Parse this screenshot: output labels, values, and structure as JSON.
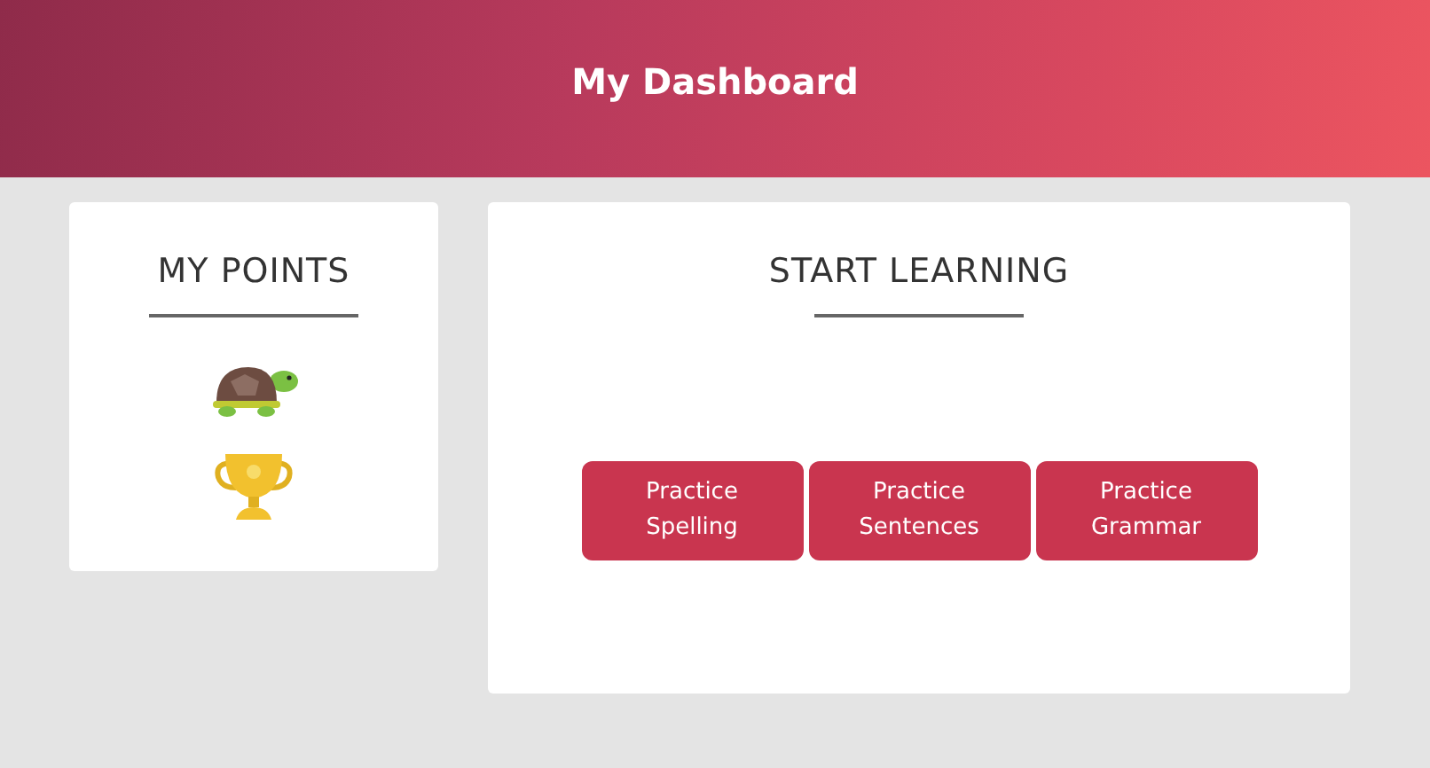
{
  "header": {
    "title": "My Dashboard"
  },
  "points": {
    "title": "MY POINTS",
    "badges": [
      {
        "kind": "turtle"
      },
      {
        "kind": "trophy"
      }
    ]
  },
  "learning": {
    "title": "START LEARNING",
    "buttons": [
      "Practice Spelling",
      "Practice Sentences",
      "Practice Grammar"
    ]
  }
}
